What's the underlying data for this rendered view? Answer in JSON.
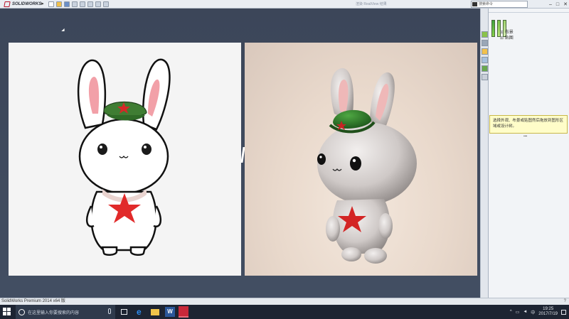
{
  "app": {
    "logo_text": "SOLIDWORKS",
    "doc_title": "渲染  RealView 结果",
    "search_placeholder": "搜索命令",
    "status_text": "SolidWorks Premium 2014 x64 版",
    "status_help": "?"
  },
  "taskpane": {
    "tree_items": [
      "布景",
      "贴图"
    ],
    "tooltip": "选择外观、布景或贴图然后拖放到图形区域或设计树。"
  },
  "taskbar": {
    "search_placeholder": "在这里输入你要搜索的内容",
    "word_label": "W",
    "time": "19:25",
    "date": "2017/7/19"
  },
  "colors": {
    "canvas_bg": "#3c4659",
    "tooltip_bg": "#fffdc9",
    "brand_red": "#b7122a",
    "hat_green": "#3f7d33",
    "star_red": "#e12a2a"
  }
}
